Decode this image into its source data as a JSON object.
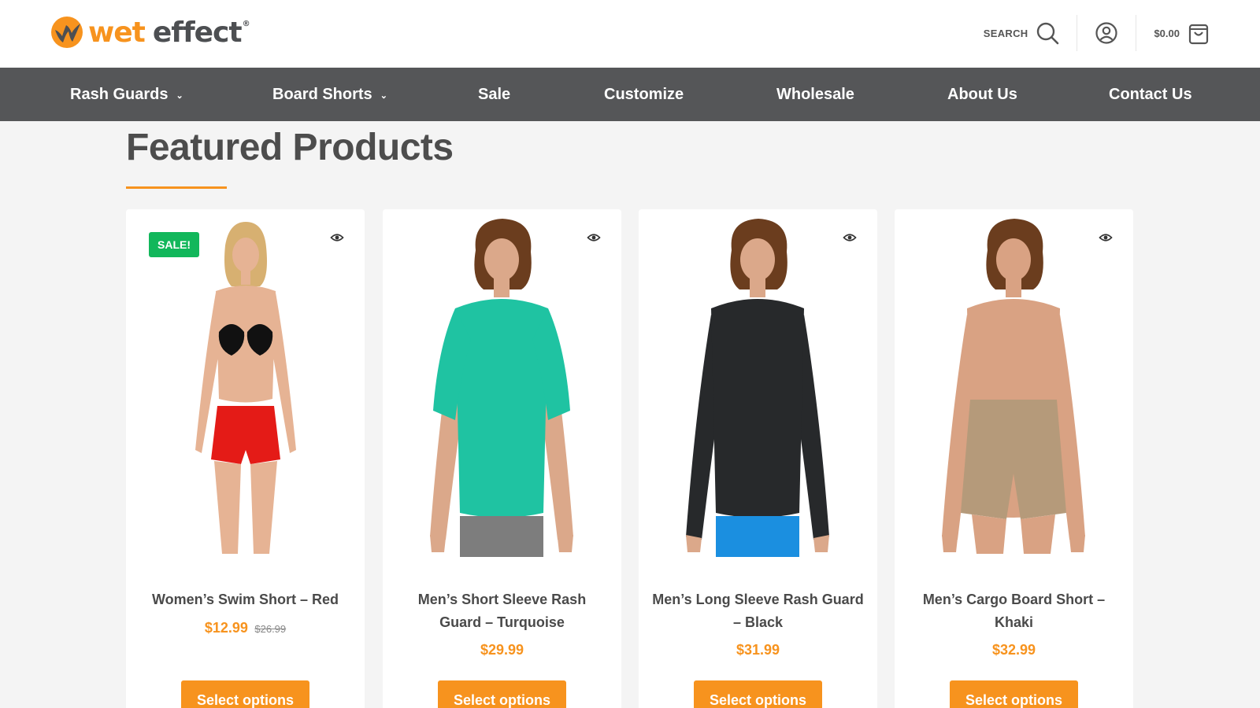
{
  "brand": {
    "name_part1": "wet",
    "name_part2": "effect",
    "registered": "®",
    "colors": {
      "orange": "#f7931e",
      "dark": "#4d4f52"
    }
  },
  "header": {
    "search_label": "SEARCH",
    "search_icon": "search-icon",
    "account_icon": "user-circle-icon",
    "cart_total": "$0.00",
    "cart_icon": "shopping-bag-icon"
  },
  "nav": {
    "background": "#555658",
    "items": [
      {
        "label": "Rash Guards",
        "has_dropdown": true
      },
      {
        "label": "Board Shorts",
        "has_dropdown": true
      },
      {
        "label": "Sale",
        "has_dropdown": false
      },
      {
        "label": "Customize",
        "has_dropdown": false
      },
      {
        "label": "Wholesale",
        "has_dropdown": false
      },
      {
        "label": "About Us",
        "has_dropdown": false
      },
      {
        "label": "Contact Us",
        "has_dropdown": false
      }
    ]
  },
  "section": {
    "title": "Featured Products"
  },
  "products": [
    {
      "badge": "SALE!",
      "name": "Women’s Swim Short – Red",
      "price": "$12.99",
      "old_price": "$26.99",
      "button": "Select options",
      "image": "woman-red-swim-short",
      "colors": {
        "top": "#111111",
        "bottom": "#e41b17",
        "skin": "#e6b394",
        "hair": "#d7b071"
      }
    },
    {
      "badge": "",
      "name": "Men’s Short Sleeve Rash Guard – Turquoise",
      "price": "$29.99",
      "old_price": "",
      "button": "Select options",
      "image": "man-turquoise-short-sleeve-rash-guard",
      "colors": {
        "top": "#1fc3a2",
        "bottom": "#7d7d7d",
        "skin": "#dba88a",
        "hair": "#6b3d1e"
      }
    },
    {
      "badge": "",
      "name": "Men’s Long Sleeve Rash Guard – Black",
      "price": "$31.99",
      "old_price": "",
      "button": "Select options",
      "image": "man-black-long-sleeve-rash-guard",
      "colors": {
        "top": "#27292b",
        "bottom": "#1b8fe0",
        "skin": "#dba88a",
        "hair": "#6b3d1e"
      }
    },
    {
      "badge": "",
      "name": "Men’s Cargo Board Short – Khaki",
      "price": "$32.99",
      "old_price": "",
      "button": "Select options",
      "image": "man-khaki-cargo-board-short",
      "colors": {
        "top": "",
        "bottom": "#b59a7a",
        "skin": "#d9a283",
        "hair": "#6b3d1e"
      }
    }
  ]
}
